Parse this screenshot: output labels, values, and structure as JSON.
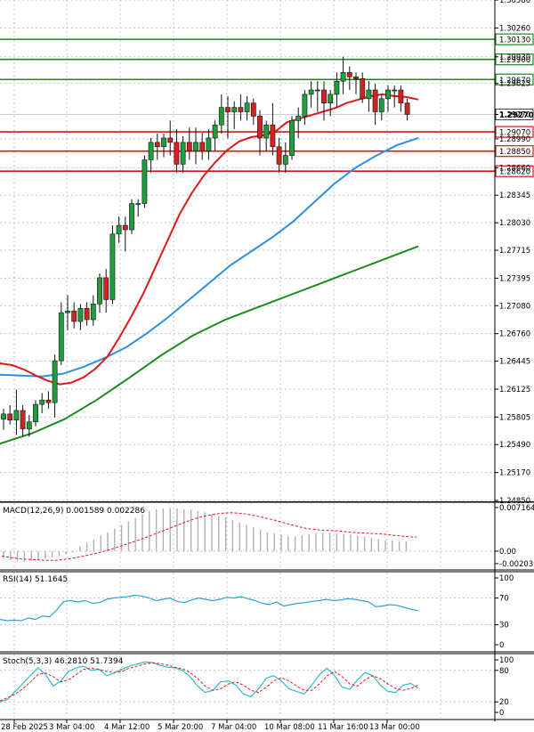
{
  "chart_data": [
    {
      "panel": "price",
      "type": "candlestick",
      "y_axis_labels": [
        "1.30580",
        "1.30260",
        "1.29930",
        "1.29625",
        "1.29270",
        "1.28990",
        "1.28660",
        "1.28345",
        "1.28030",
        "1.27715",
        "1.27395",
        "1.27080",
        "1.26760",
        "1.26445",
        "1.26125",
        "1.25805",
        "1.25490",
        "1.25170",
        "1.24850"
      ],
      "ylim": [
        1.2485,
        1.3058
      ],
      "horizontal_levels": [
        {
          "value": 1.3013,
          "label": "1.30130",
          "kind": "resistance",
          "color": "#1a8a1a"
        },
        {
          "value": 1.299,
          "label": "1.29900",
          "kind": "resistance",
          "color": "#1a8a1a"
        },
        {
          "value": 1.2967,
          "label": "1.29670",
          "kind": "resistance",
          "color": "#1a8a1a"
        },
        {
          "value": 1.2907,
          "label": "1.29070",
          "kind": "support",
          "color": "#d01a1a"
        },
        {
          "value": 1.2885,
          "label": "1.28850",
          "kind": "support",
          "color": "#d01a1a"
        },
        {
          "value": 1.2862,
          "label": "1.28620",
          "kind": "support",
          "color": "#d01a1a"
        }
      ],
      "current_price": {
        "value": 1.2927,
        "label": "1.29270"
      },
      "candles": [
        [
          1.2578,
          1.259,
          1.2566,
          1.2584
        ],
        [
          1.2584,
          1.2594,
          1.2572,
          1.2577
        ],
        [
          1.2577,
          1.2612,
          1.256,
          1.2588
        ],
        [
          1.2588,
          1.2594,
          1.2558,
          1.2567
        ],
        [
          1.2567,
          1.2583,
          1.2558,
          1.2575
        ],
        [
          1.2575,
          1.26,
          1.257,
          1.2595
        ],
        [
          1.2595,
          1.2608,
          1.2585,
          1.26
        ],
        [
          1.26,
          1.261,
          1.259,
          1.2597
        ],
        [
          1.2597,
          1.2652,
          1.258,
          1.2645
        ],
        [
          1.2645,
          1.2712,
          1.264,
          1.27
        ],
        [
          1.27,
          1.272,
          1.268,
          1.2702
        ],
        [
          1.2702,
          1.2712,
          1.2682,
          1.269
        ],
        [
          1.269,
          1.271,
          1.268,
          1.2705
        ],
        [
          1.2705,
          1.2712,
          1.2685,
          1.2692
        ],
        [
          1.2692,
          1.272,
          1.2685,
          1.271
        ],
        [
          1.271,
          1.2745,
          1.27,
          1.274
        ],
        [
          1.274,
          1.275,
          1.27,
          1.2715
        ],
        [
          1.2715,
          1.28,
          1.271,
          1.279
        ],
        [
          1.279,
          1.281,
          1.278,
          1.28
        ],
        [
          1.28,
          1.281,
          1.277,
          1.2795
        ],
        [
          1.2795,
          1.283,
          1.279,
          1.2825
        ],
        [
          1.2825,
          1.283,
          1.281,
          1.2825
        ],
        [
          1.2825,
          1.288,
          1.282,
          1.2875
        ],
        [
          1.2875,
          1.29,
          1.286,
          1.2895
        ],
        [
          1.2895,
          1.2905,
          1.2875,
          1.289
        ],
        [
          1.289,
          1.2905,
          1.2878,
          1.29
        ],
        [
          1.29,
          1.292,
          1.288,
          1.2895
        ],
        [
          1.2895,
          1.291,
          1.286,
          1.287
        ],
        [
          1.287,
          1.2902,
          1.286,
          1.2895
        ],
        [
          1.2895,
          1.2912,
          1.2875,
          1.2885
        ],
        [
          1.2885,
          1.2912,
          1.287,
          1.2895
        ],
        [
          1.2895,
          1.2906,
          1.2875,
          1.2885
        ],
        [
          1.2885,
          1.291,
          1.2875,
          1.29
        ],
        [
          1.29,
          1.292,
          1.2885,
          1.2915
        ],
        [
          1.2915,
          1.295,
          1.2905,
          1.2935
        ],
        [
          1.2935,
          1.2948,
          1.29,
          1.293
        ],
        [
          1.293,
          1.2942,
          1.291,
          1.2935
        ],
        [
          1.2935,
          1.295,
          1.292,
          1.293
        ],
        [
          1.293,
          1.2948,
          1.292,
          1.294
        ],
        [
          1.294,
          1.2945,
          1.2915,
          1.2925
        ],
        [
          1.2925,
          1.2932,
          1.288,
          1.29
        ],
        [
          1.29,
          1.292,
          1.2885,
          1.2915
        ],
        [
          1.2915,
          1.294,
          1.288,
          1.289
        ],
        [
          1.289,
          1.29,
          1.286,
          1.287
        ],
        [
          1.287,
          1.2895,
          1.286,
          1.288
        ],
        [
          1.288,
          1.2925,
          1.2875,
          1.292
        ],
        [
          1.292,
          1.2935,
          1.29,
          1.2925
        ],
        [
          1.2925,
          1.2955,
          1.2915,
          1.295
        ],
        [
          1.295,
          1.2965,
          1.2935,
          1.2955
        ],
        [
          1.2955,
          1.2965,
          1.293,
          1.2955
        ],
        [
          1.2955,
          1.2965,
          1.292,
          1.294
        ],
        [
          1.294,
          1.2955,
          1.2925,
          1.295
        ],
        [
          1.295,
          1.2975,
          1.2935,
          1.2965
        ],
        [
          1.2965,
          1.2993,
          1.295,
          1.2975
        ],
        [
          1.2975,
          1.2982,
          1.2955,
          1.297
        ],
        [
          1.297,
          1.2975,
          1.295,
          1.2968
        ],
        [
          1.2968,
          1.2975,
          1.294,
          1.2945
        ],
        [
          1.2945,
          1.2965,
          1.293,
          1.2955
        ],
        [
          1.2955,
          1.2962,
          1.2915,
          1.293
        ],
        [
          1.293,
          1.295,
          1.292,
          1.2945
        ],
        [
          1.2945,
          1.296,
          1.293,
          1.2955
        ],
        [
          1.2955,
          1.296,
          1.2935,
          1.2955
        ],
        [
          1.2955,
          1.296,
          1.293,
          1.294
        ],
        [
          1.294,
          1.2945,
          1.292,
          1.2927
        ]
      ],
      "ma_red": [
        1.2642,
        1.264,
        1.2635,
        1.2628,
        1.2622,
        1.2618,
        1.262,
        1.2626,
        1.2636,
        1.265,
        1.2672,
        1.2696,
        1.2722,
        1.2752,
        1.2782,
        1.2812,
        1.2836,
        1.2856,
        1.2872,
        1.2886,
        1.2896,
        1.2901,
        1.2903,
        1.2907,
        1.2918,
        1.2922,
        1.2926,
        1.293,
        1.2934,
        1.294,
        1.2944,
        1.2948,
        1.295,
        1.2948,
        1.2947,
        1.2944
      ],
      "ma_blue": [
        1.2629,
        1.2628,
        1.2627,
        1.263,
        1.2638,
        1.2648,
        1.266,
        1.2676,
        1.2694,
        1.2714,
        1.2734,
        1.2754,
        1.277,
        1.2786,
        1.2804,
        1.2826,
        1.2848,
        1.2866,
        1.288,
        1.2892,
        1.29
      ],
      "ma_green": [
        1.255,
        1.2562,
        1.2578,
        1.26,
        1.2625,
        1.2651,
        1.2674,
        1.2692,
        1.2706,
        1.272,
        1.2734,
        1.2748,
        1.2762,
        1.2776
      ],
      "x_tick_labels": [
        "28 Feb 2025",
        "3 Mar 04:00",
        "4 Mar 12:00",
        "5 Mar 20:00",
        "7 Mar 04:00",
        "10 Mar 08:00",
        "11 Mar 16:00",
        "13 Mar 00:00"
      ]
    },
    {
      "panel": "macd",
      "type": "histogram+line",
      "label": "MACD(12,26,9) 0.001589 0.002286",
      "y_axis_labels": [
        "0.007164",
        "0.00",
        "-0.002039"
      ],
      "ylim": [
        -0.0022,
        0.0073
      ],
      "histogram": [
        -0.0012,
        -0.0015,
        -0.0016,
        -0.0017,
        -0.0016,
        -0.0014,
        -0.0012,
        -0.001,
        -0.0008,
        -0.0005,
        -0.0002,
        0.0008,
        0.0014,
        0.0019,
        0.0025,
        0.0031,
        0.0037,
        0.0043,
        0.0049,
        0.0055,
        0.0061,
        0.0066,
        0.0069,
        0.007,
        0.0071,
        0.007,
        0.0069,
        0.0068,
        0.0066,
        0.0064,
        0.0061,
        0.0058,
        0.0055,
        0.0051,
        0.0047,
        0.0043,
        0.0039,
        0.0035,
        0.0031,
        0.0029,
        0.0027,
        0.0025,
        0.0024,
        0.0026,
        0.0028,
        0.003,
        0.0031,
        0.003,
        0.0029,
        0.0028,
        0.0027,
        0.0026,
        0.0024,
        0.0022,
        0.002,
        0.0018,
        0.0017,
        0.0016,
        0.0016
      ],
      "signal": [
        -0.0008,
        -0.0011,
        -0.0013,
        -0.0014,
        -0.0015,
        -0.0015,
        -0.0013,
        -0.001,
        -0.0006,
        -0.0002,
        0.0003,
        0.0009,
        0.0015,
        0.0021,
        0.0028,
        0.0035,
        0.0042,
        0.0049,
        0.0055,
        0.0059,
        0.0062,
        0.0063,
        0.0062,
        0.0059,
        0.0055,
        0.0051,
        0.0046,
        0.0041,
        0.0037,
        0.0035,
        0.0034,
        0.0033,
        0.0031,
        0.003,
        0.0029,
        0.0028,
        0.0026,
        0.0024,
        0.0023
      ]
    },
    {
      "panel": "rsi",
      "type": "line",
      "label": "RSI(14) 51.1645",
      "y_axis_labels": [
        "100",
        "70",
        "30",
        "0"
      ],
      "ylim": [
        0,
        100
      ],
      "values": [
        38,
        36,
        37,
        36,
        40,
        38,
        43,
        42,
        52,
        65,
        66,
        64,
        66,
        62,
        63,
        68,
        70,
        71,
        72,
        74,
        73,
        70,
        66,
        68,
        70,
        65,
        63,
        67,
        70,
        68,
        66,
        68,
        71,
        70,
        72,
        69,
        66,
        62,
        60,
        64,
        58,
        60,
        62,
        63,
        65,
        66,
        68,
        66,
        67,
        69,
        68,
        66,
        64,
        57,
        58,
        60,
        59,
        56,
        53,
        51
      ]
    },
    {
      "panel": "stoch",
      "type": "line",
      "label": "Stoch(5,3,3) 46.2810 51.7394",
      "y_axis_labels": [
        "100",
        "80",
        "20",
        "0"
      ],
      "ylim": [
        0,
        100
      ],
      "k": [
        20,
        25,
        40,
        55,
        70,
        85,
        72,
        50,
        60,
        78,
        85,
        88,
        80,
        82,
        70,
        75,
        82,
        88,
        92,
        96,
        95,
        90,
        86,
        85,
        80,
        68,
        50,
        38,
        42,
        58,
        60,
        52,
        35,
        30,
        45,
        65,
        70,
        60,
        45,
        40,
        35,
        52,
        72,
        84,
        70,
        48,
        44,
        62,
        76,
        70,
        52,
        40,
        38,
        52,
        55,
        46
      ],
      "d": [
        22,
        28,
        35,
        45,
        58,
        72,
        75,
        68,
        58,
        62,
        72,
        82,
        84,
        82,
        78,
        76,
        78,
        84,
        88,
        92,
        94,
        93,
        90,
        86,
        83,
        76,
        64,
        50,
        42,
        45,
        54,
        58,
        52,
        42,
        38,
        48,
        60,
        66,
        60,
        50,
        42,
        42,
        54,
        70,
        78,
        68,
        54,
        50,
        62,
        70,
        64,
        54,
        46,
        42,
        46,
        52
      ]
    }
  ]
}
